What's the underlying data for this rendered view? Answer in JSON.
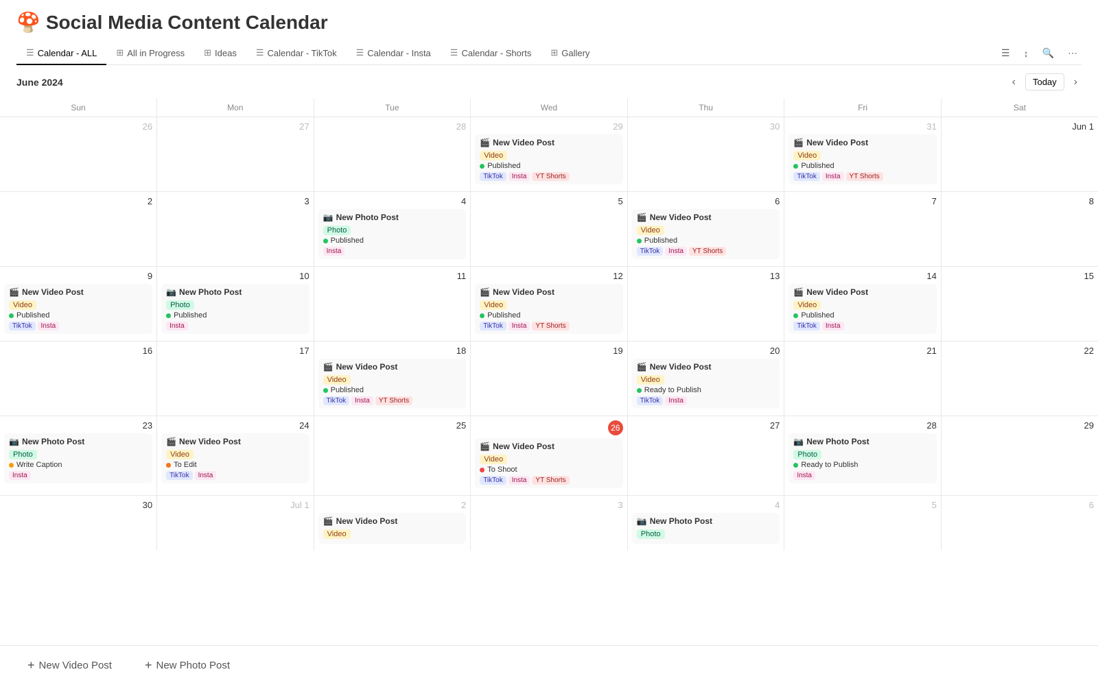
{
  "app": {
    "title": "Social Media Content Calendar",
    "emoji": "🍄"
  },
  "nav": {
    "tabs": [
      {
        "id": "calendar-all",
        "label": "Calendar - ALL",
        "icon": "☰",
        "active": true
      },
      {
        "id": "all-in-progress",
        "label": "All in Progress",
        "icon": "⊞",
        "active": false
      },
      {
        "id": "ideas",
        "label": "Ideas",
        "icon": "⊞",
        "active": false
      },
      {
        "id": "calendar-tiktok",
        "label": "Calendar - TikTok",
        "icon": "☰",
        "active": false
      },
      {
        "id": "calendar-insta",
        "label": "Calendar - Insta",
        "icon": "☰",
        "active": false
      },
      {
        "id": "calendar-shorts",
        "label": "Calendar - Shorts",
        "icon": "☰",
        "active": false
      },
      {
        "id": "gallery",
        "label": "Gallery",
        "icon": "⊞",
        "active": false
      }
    ],
    "actions": [
      "filter",
      "sort",
      "search",
      "more"
    ]
  },
  "calendar": {
    "month": "June 2024",
    "today_label": "Today",
    "days_of_week": [
      "Sun",
      "Mon",
      "Tue",
      "Wed",
      "Thu",
      "Fri",
      "Sat"
    ]
  },
  "bottom_bar": {
    "new_video": "New Video Post",
    "new_photo": "New Photo Post"
  },
  "weeks": [
    {
      "days": [
        {
          "num": "26",
          "other_month": true,
          "events": []
        },
        {
          "num": "27",
          "other_month": true,
          "events": []
        },
        {
          "num": "28",
          "other_month": true,
          "events": []
        },
        {
          "num": "29",
          "other_month": true,
          "events": [
            {
              "title": "New Video Post",
              "emoji": "🎬",
              "type": "video",
              "status": "Published",
              "status_type": "published",
              "platforms": [
                "TikTok",
                "Insta",
                "YT Shorts"
              ]
            }
          ]
        },
        {
          "num": "30",
          "other_month": true,
          "events": []
        },
        {
          "num": "31",
          "other_month": true,
          "events": [
            {
              "title": "New Video Post",
              "emoji": "🎬",
              "type": "video",
              "status": "Published",
              "status_type": "published",
              "platforms": [
                "TikTok",
                "Insta",
                "YT Shorts"
              ]
            }
          ]
        },
        {
          "num": "Jun 1",
          "other_month": false,
          "events": []
        }
      ]
    },
    {
      "days": [
        {
          "num": "2",
          "events": []
        },
        {
          "num": "3",
          "events": []
        },
        {
          "num": "4",
          "events": [
            {
              "title": "New Photo Post",
              "emoji": "📷",
              "type": "photo",
              "status": "Published",
              "status_type": "published",
              "platforms": [
                "Insta"
              ]
            }
          ]
        },
        {
          "num": "5",
          "events": []
        },
        {
          "num": "6",
          "events": [
            {
              "title": "New Video Post",
              "emoji": "🎬",
              "type": "video",
              "status": "Published",
              "status_type": "published",
              "platforms": [
                "TikTok",
                "Insta",
                "YT Shorts"
              ]
            }
          ]
        },
        {
          "num": "7",
          "events": []
        },
        {
          "num": "8",
          "events": []
        }
      ]
    },
    {
      "days": [
        {
          "num": "9",
          "events": [
            {
              "title": "New Video Post",
              "emoji": "🎬",
              "type": "video",
              "status": "Published",
              "status_type": "published",
              "platforms": [
                "TikTok",
                "Insta"
              ]
            }
          ]
        },
        {
          "num": "10",
          "events": [
            {
              "title": "New Photo Post",
              "emoji": "📷",
              "type": "photo",
              "status": "Published",
              "status_type": "published",
              "platforms": [
                "Insta"
              ]
            }
          ]
        },
        {
          "num": "11",
          "events": []
        },
        {
          "num": "12",
          "events": [
            {
              "title": "New Video Post",
              "emoji": "🎬",
              "type": "video",
              "status": "Published",
              "status_type": "published",
              "platforms": [
                "TikTok",
                "Insta",
                "YT Shorts"
              ]
            }
          ]
        },
        {
          "num": "13",
          "events": []
        },
        {
          "num": "14",
          "events": [
            {
              "title": "New Video Post",
              "emoji": "🎬",
              "type": "video",
              "status": "Published",
              "status_type": "published",
              "platforms": [
                "TikTok",
                "Insta"
              ]
            }
          ]
        },
        {
          "num": "15",
          "events": []
        }
      ]
    },
    {
      "days": [
        {
          "num": "16",
          "events": []
        },
        {
          "num": "17",
          "events": []
        },
        {
          "num": "18",
          "events": [
            {
              "title": "New Video Post",
              "emoji": "🎬",
              "type": "video",
              "status": "Published",
              "status_type": "published",
              "platforms": [
                "TikTok",
                "Insta",
                "YT Shorts"
              ]
            }
          ]
        },
        {
          "num": "19",
          "events": []
        },
        {
          "num": "20",
          "events": [
            {
              "title": "New Video Post",
              "emoji": "🎬",
              "type": "video",
              "status": "Ready to Publish",
              "status_type": "ready",
              "platforms": [
                "TikTok",
                "Insta"
              ]
            }
          ]
        },
        {
          "num": "21",
          "events": []
        },
        {
          "num": "22",
          "events": []
        }
      ]
    },
    {
      "days": [
        {
          "num": "23",
          "events": [
            {
              "title": "New Photo Post",
              "emoji": "📷",
              "type": "photo",
              "status": "Write Caption",
              "status_type": "write-caption",
              "platforms": [
                "Insta"
              ]
            }
          ]
        },
        {
          "num": "24",
          "events": [
            {
              "title": "New Video Post",
              "emoji": "🎬",
              "type": "video",
              "status": "To Edit",
              "status_type": "to-edit",
              "platforms": [
                "TikTok",
                "Insta"
              ]
            }
          ]
        },
        {
          "num": "25",
          "events": []
        },
        {
          "num": "26",
          "today": true,
          "events": [
            {
              "title": "New Video Post",
              "emoji": "🎬",
              "type": "video",
              "status": "To Shoot",
              "status_type": "to-shoot",
              "platforms": [
                "TikTok",
                "Insta",
                "YT Shorts"
              ]
            }
          ]
        },
        {
          "num": "27",
          "events": []
        },
        {
          "num": "28",
          "events": [
            {
              "title": "New Photo Post",
              "emoji": "📷",
              "type": "photo",
              "status": "Ready to Publish",
              "status_type": "ready",
              "platforms": [
                "Insta"
              ]
            }
          ]
        },
        {
          "num": "29",
          "events": []
        }
      ]
    },
    {
      "days": [
        {
          "num": "30",
          "events": []
        },
        {
          "num": "Jul 1",
          "other_month": true,
          "events": []
        },
        {
          "num": "2",
          "other_month": true,
          "events": [
            {
              "title": "New Video Post",
              "emoji": "🎬",
              "type": "video",
              "status": "",
              "status_type": "",
              "platforms": []
            }
          ]
        },
        {
          "num": "3",
          "other_month": true,
          "events": []
        },
        {
          "num": "4",
          "other_month": true,
          "events": [
            {
              "title": "New Photo Post",
              "emoji": "📷",
              "type": "photo",
              "status": "",
              "status_type": "",
              "platforms": []
            }
          ]
        },
        {
          "num": "5",
          "other_month": true,
          "events": []
        },
        {
          "num": "6",
          "other_month": true,
          "events": []
        }
      ]
    }
  ]
}
